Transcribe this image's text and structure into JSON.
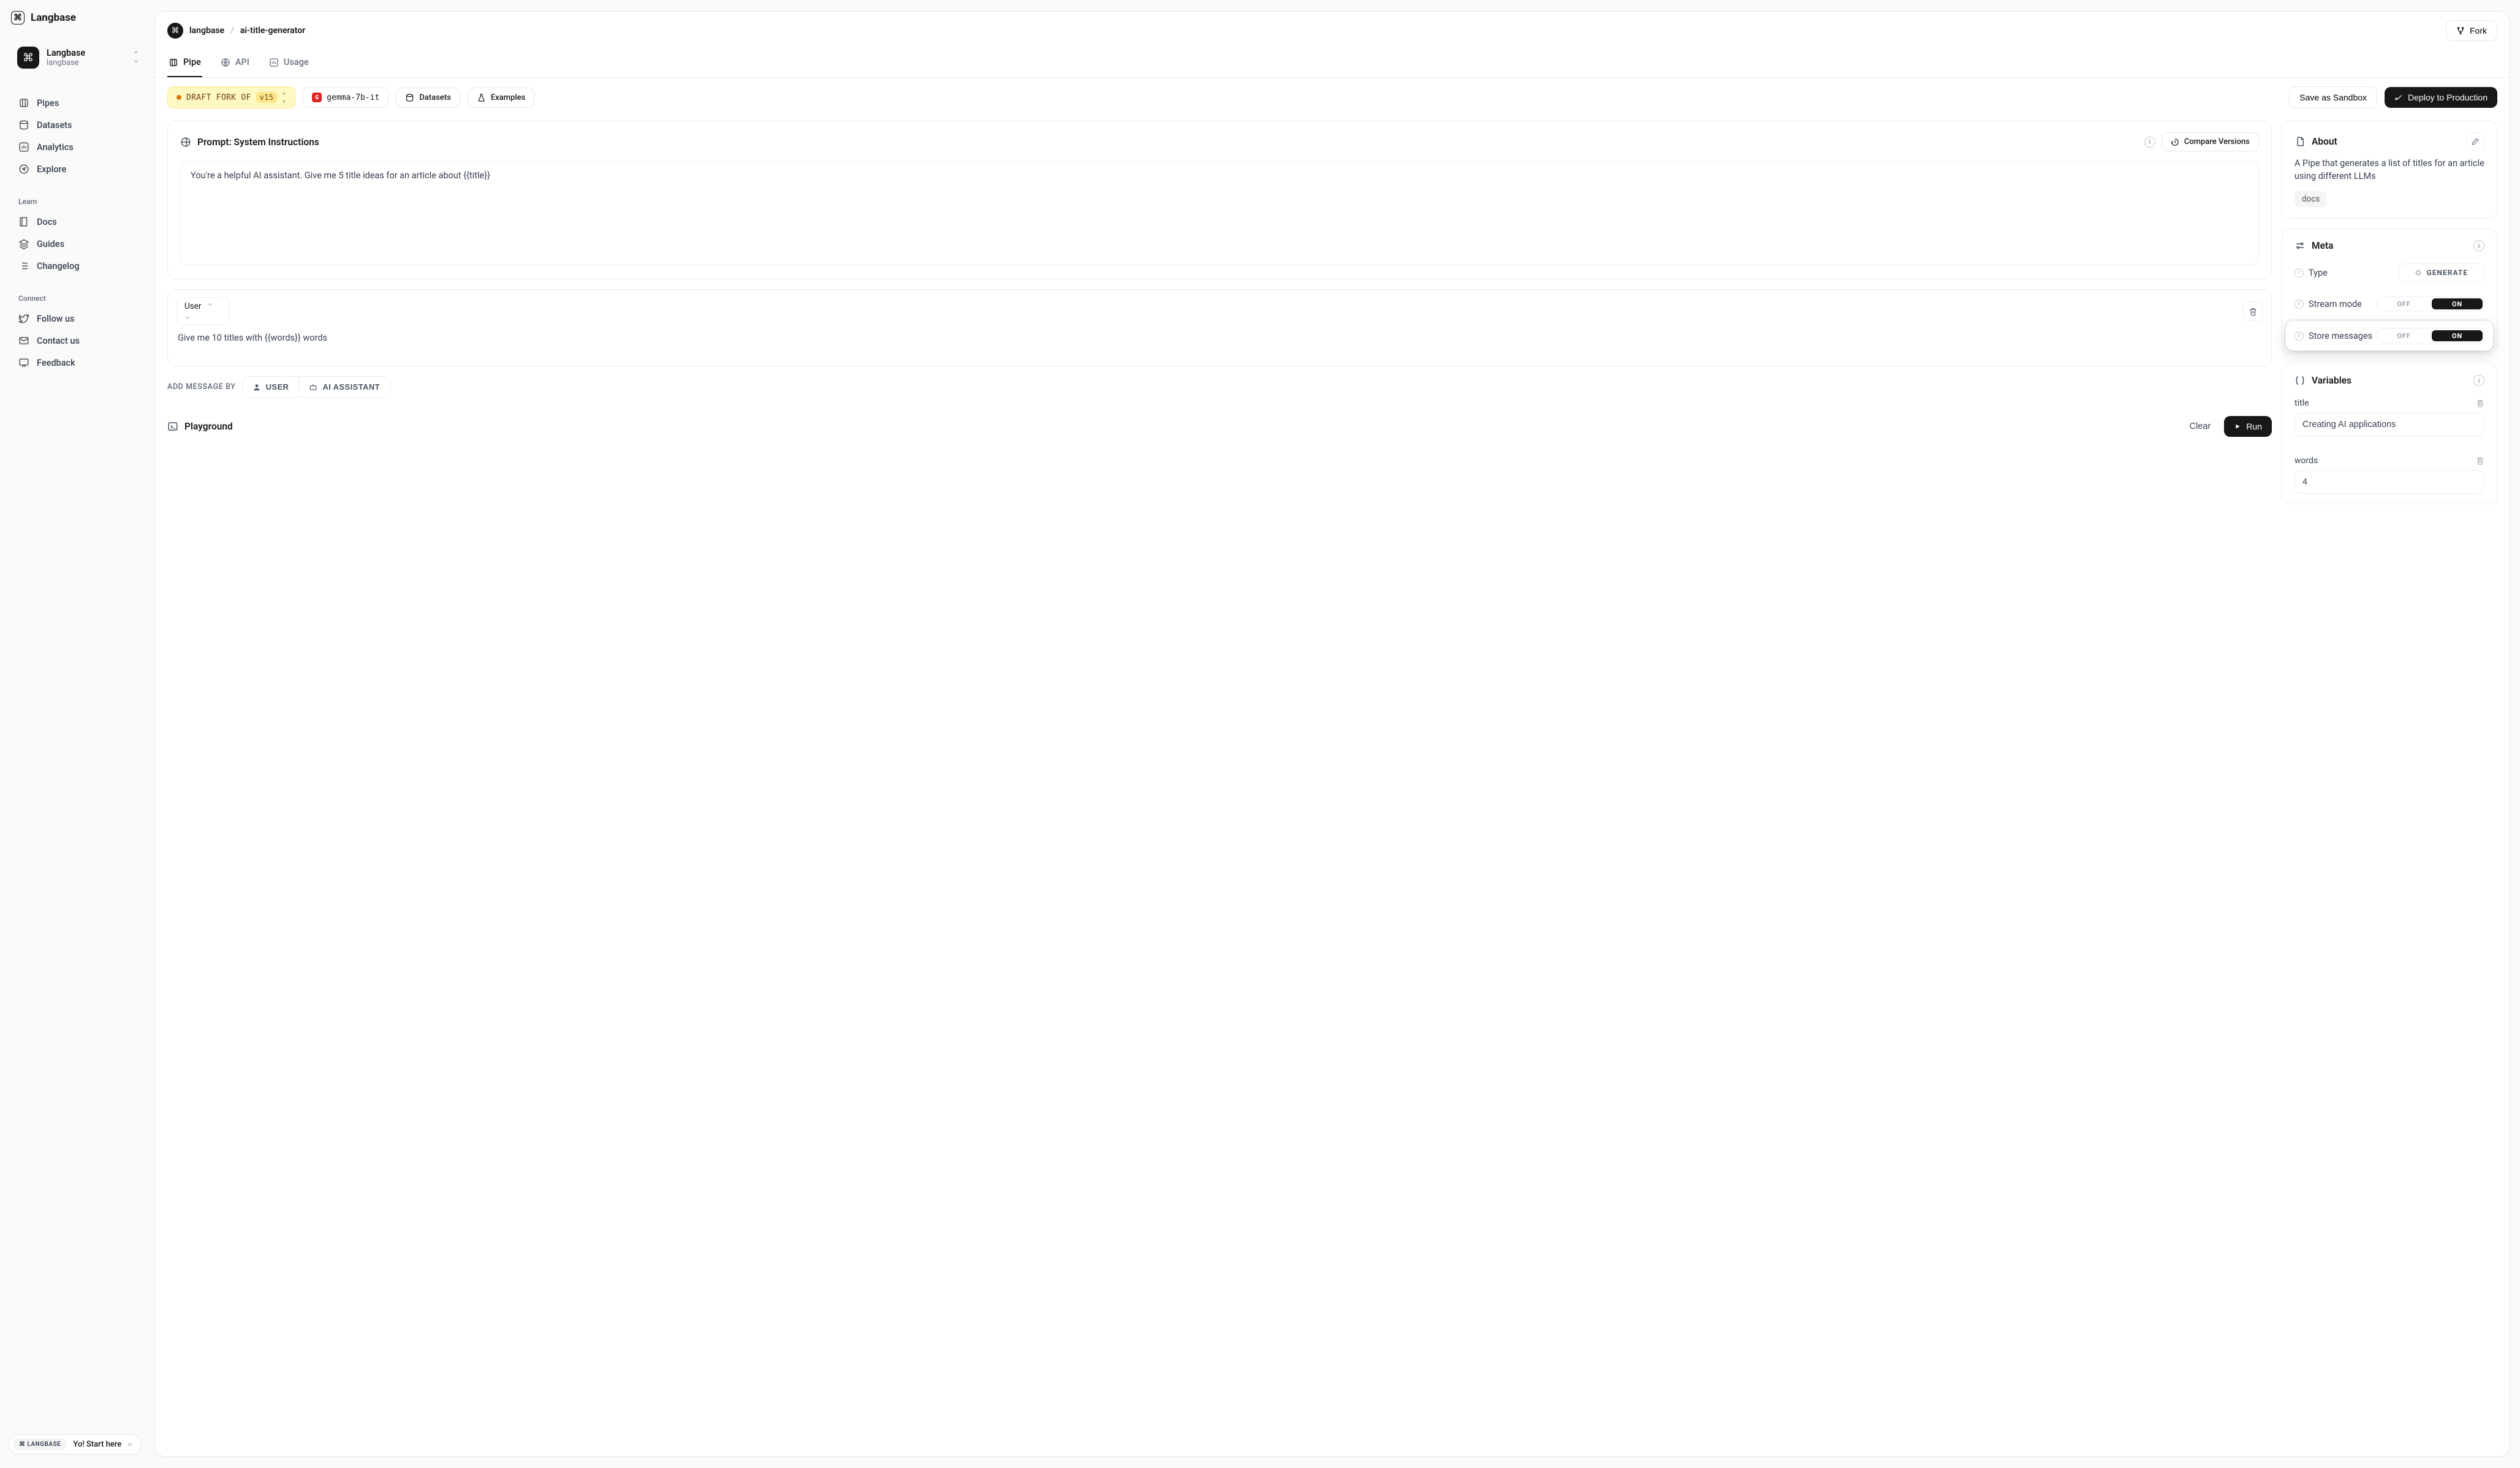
{
  "brand": "Langbase",
  "workspace": {
    "name": "Langbase",
    "handle": "langbase"
  },
  "nav": {
    "main": [
      {
        "label": "Pipes"
      },
      {
        "label": "Datasets"
      },
      {
        "label": "Analytics"
      },
      {
        "label": "Explore"
      }
    ],
    "learn_heading": "Learn",
    "learn": [
      {
        "label": "Docs"
      },
      {
        "label": "Guides"
      },
      {
        "label": "Changelog"
      }
    ],
    "connect_heading": "Connect",
    "connect": [
      {
        "label": "Follow us"
      },
      {
        "label": "Contact us"
      },
      {
        "label": "Feedback"
      }
    ]
  },
  "start_pill": {
    "badge": "⌘ LANGBASE",
    "text": "Yo! Start here"
  },
  "header": {
    "org": "langbase",
    "separator": "/",
    "pipe": "ai-title-generator",
    "fork_label": "Fork"
  },
  "tabs": [
    {
      "label": "Pipe",
      "active": true
    },
    {
      "label": "API",
      "active": false
    },
    {
      "label": "Usage",
      "active": false
    }
  ],
  "toolbar": {
    "draft_prefix": "DRAFT FORK OF",
    "draft_version": "v15",
    "model": "gemma-7b-it",
    "model_badge_letter": "G",
    "datasets_label": "Datasets",
    "examples_label": "Examples",
    "save_label": "Save as Sandbox",
    "deploy_label": "Deploy to Production"
  },
  "prompt": {
    "title": "Prompt: System Instructions",
    "compare_label": "Compare Versions",
    "text": "You're a helpful AI assistant. Give me 5 title ideas for an article about {{title}}"
  },
  "messages": [
    {
      "role": "User",
      "text": "Give me 10 titles with {{words}} words"
    }
  ],
  "add_message": {
    "label": "ADD MESSAGE BY",
    "user_label": "USER",
    "assistant_label": "AI ASSISTANT"
  },
  "playground": {
    "title": "Playground",
    "clear_label": "Clear",
    "run_label": "Run"
  },
  "about": {
    "title": "About",
    "description": "A Pipe that generates a list of titles for an article using different LLMs",
    "tag": "docs"
  },
  "meta": {
    "title": "Meta",
    "type_label": "Type",
    "type_value": "GENERATE",
    "stream_label": "Stream mode",
    "stream_on": true,
    "store_label": "Store messages",
    "store_on": true,
    "off_label": "OFF",
    "on_label": "ON"
  },
  "variables": {
    "title": "Variables",
    "items": [
      {
        "name": "title",
        "value": "Creating AI applications"
      },
      {
        "name": "words",
        "value": "4"
      }
    ]
  }
}
